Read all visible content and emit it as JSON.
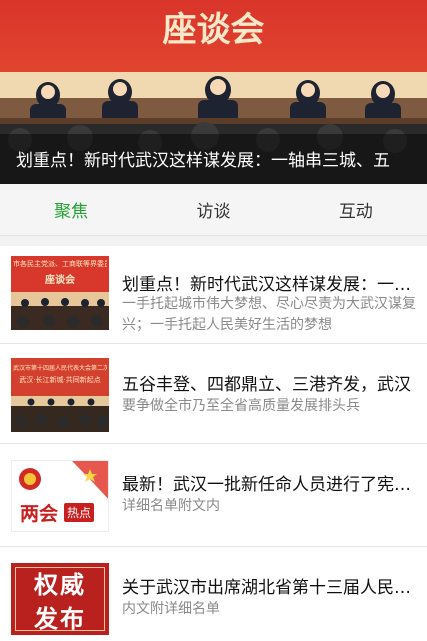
{
  "hero": {
    "banner_text": "座谈会",
    "title": "划重点！新时代武汉这样谋发展：一轴串三城、五",
    "colors": {
      "banner_red": "#d9352a",
      "stage": "#7d5a40",
      "audience": "#2a2a2a"
    }
  },
  "tabs": [
    {
      "label": "聚焦",
      "active": true
    },
    {
      "label": "访谈",
      "active": false
    },
    {
      "label": "互动",
      "active": false
    }
  ],
  "colors": {
    "accent_green": "#23a234"
  },
  "articles": [
    {
      "thumb_banner": "市各民主党派、工商联等界委员",
      "thumb_subbanner": "座谈会",
      "title": "划重点！新时代武汉这样谋发展：一轴串三城、五",
      "summary": "一手托起城市伟大梦想、尽心尽责为大武汉谋复兴；一手托起人民美好生活的梦想"
    },
    {
      "thumb_banner": "武汉市第十四届人民代表大会第二次会议",
      "thumb_subbanner": "武汉·长江新城·共同新起点",
      "title": "五谷丰登、四都鼎立、三港齐发，武汉",
      "summary": "要争做全市乃至全省高质量发展排头兵"
    },
    {
      "thumb_text_1": "两会",
      "thumb_text_2": "热点",
      "title": "最新！武汉一批新任命人员进行了宪法宣誓",
      "summary": "详细名单附文内"
    },
    {
      "thumb_text_1": "权威",
      "thumb_text_2": "发布",
      "title": "关于武汉市出席湖北省第十三届人民代表大会",
      "summary": "内文附详细名单"
    }
  ]
}
